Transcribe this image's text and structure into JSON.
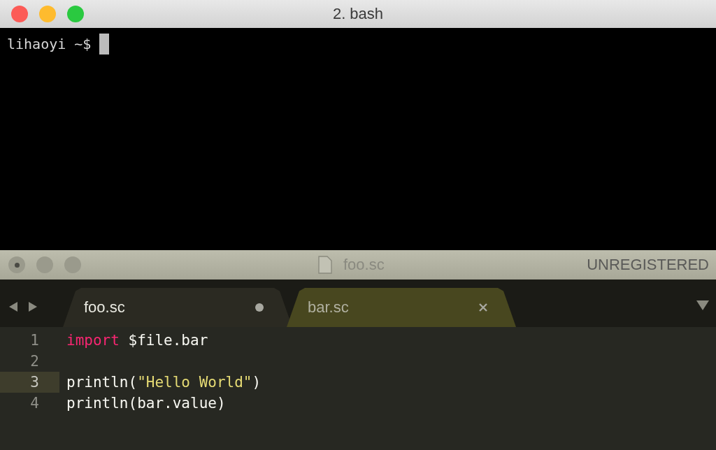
{
  "terminal": {
    "title": "2. bash",
    "prompt": "lihaoyi ~$"
  },
  "editor": {
    "title": "foo.sc",
    "badge": "UNREGISTERED",
    "tabs": [
      {
        "label": "foo.sc",
        "selected": true,
        "modified": true
      },
      {
        "label": "bar.sc",
        "selected": false,
        "modified": false
      }
    ],
    "lines": [
      {
        "number": "1",
        "current": false,
        "tokens": [
          {
            "kind": "keyword",
            "text": "import"
          },
          {
            "kind": "plain",
            "text": " $file.bar"
          }
        ]
      },
      {
        "number": "2",
        "current": false
      },
      {
        "number": "3",
        "current": true,
        "tokens": [
          {
            "kind": "plain",
            "text": "println("
          },
          {
            "kind": "string",
            "text": "\"Hello World\""
          },
          {
            "kind": "plain",
            "text": ")"
          }
        ]
      },
      {
        "number": "4",
        "current": false,
        "tokens": [
          {
            "kind": "plain",
            "text": "println(bar.value)"
          }
        ]
      }
    ]
  }
}
